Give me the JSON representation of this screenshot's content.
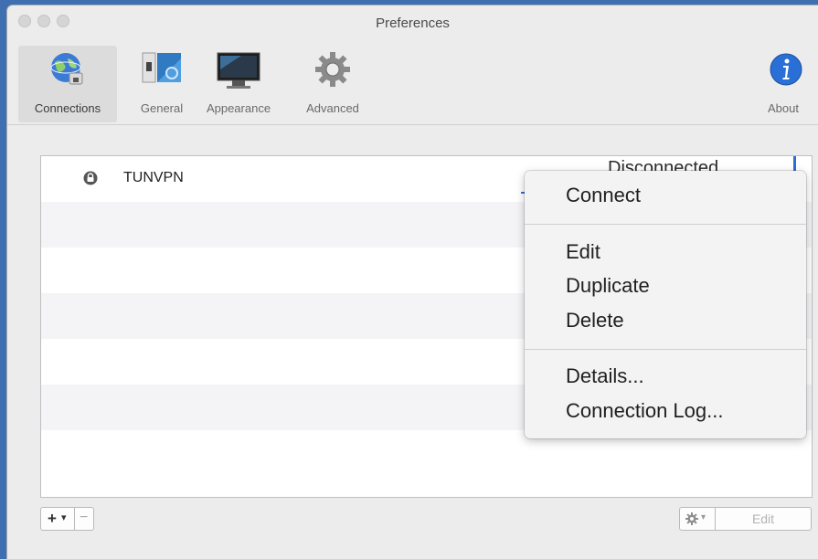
{
  "window": {
    "title": "Preferences"
  },
  "toolbar": {
    "items": [
      {
        "label": "Connections",
        "icon": "globe-network-icon",
        "selected": true
      },
      {
        "label": "General",
        "icon": "general-settings-icon"
      },
      {
        "label": "Appearance",
        "icon": "display-monitor-icon"
      },
      {
        "label": "Advanced",
        "icon": "gear-icon"
      }
    ],
    "about": {
      "label": "About",
      "icon": "info-icon"
    }
  },
  "connections": [
    {
      "name": "TUNVPN",
      "status": "Disconnected",
      "icon": "lock-icon"
    }
  ],
  "context_menu": {
    "connect": "Connect",
    "edit": "Edit",
    "duplicate": "Duplicate",
    "delete": "Delete",
    "details": "Details...",
    "connection_log": "Connection Log..."
  },
  "bottom_bar": {
    "add": "+",
    "add_menu": "▾",
    "remove": "−",
    "action_menu": "▾",
    "edit": "Edit"
  },
  "colors": {
    "accent": "#2b6fd3",
    "desktop": "#3f6fb0"
  }
}
